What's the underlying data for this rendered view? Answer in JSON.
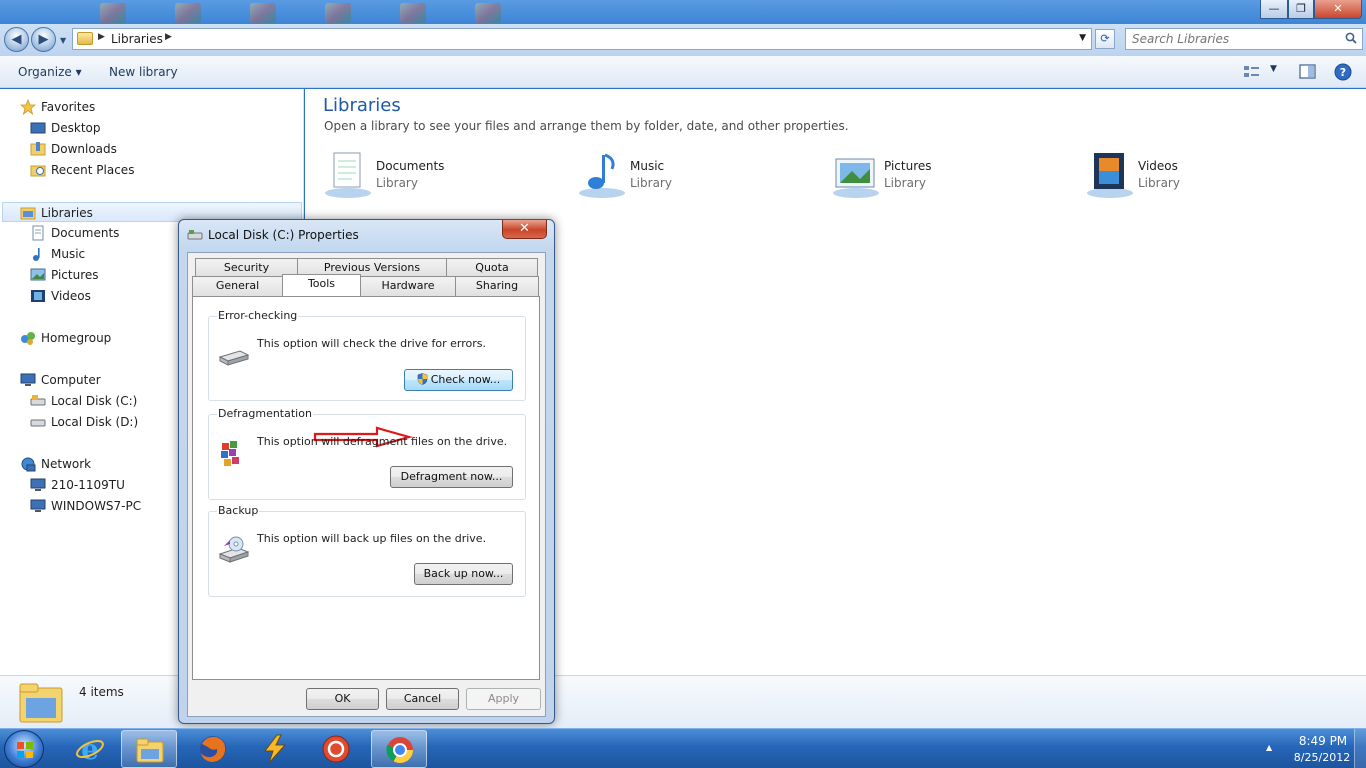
{
  "window": {
    "minimize_glyph": "—",
    "maximize_glyph": "❐",
    "close_glyph": "✕"
  },
  "address": {
    "path": "Libraries",
    "search_placeholder": "Search Libraries",
    "back_glyph": "◀",
    "forward_glyph": "▶"
  },
  "toolbar": {
    "organize": "Organize ▾",
    "new_library": "New library"
  },
  "nav": {
    "favorites": "Favorites",
    "desktop": "Desktop",
    "downloads": "Downloads",
    "recent_places": "Recent Places",
    "libraries": "Libraries",
    "documents": "Documents",
    "music": "Music",
    "pictures": "Pictures",
    "videos": "Videos",
    "homegroup": "Homegroup",
    "computer": "Computer",
    "local_c": "Local Disk (C:)",
    "local_d": "Local Disk (D:)",
    "network": "Network",
    "pc1": "210-1109TU",
    "pc2": "WINDOWS7-PC"
  },
  "content": {
    "title": "Libraries",
    "subtitle": "Open a library to see your files and arrange them by folder, date, and other properties.",
    "libraries": [
      {
        "name": "Documents",
        "type": "Library"
      },
      {
        "name": "Music",
        "type": "Library"
      },
      {
        "name": "Pictures",
        "type": "Library"
      },
      {
        "name": "Videos",
        "type": "Library"
      }
    ]
  },
  "details": {
    "count": "4 items"
  },
  "dialog": {
    "title": "Local Disk (C:) Properties",
    "tabs_top": [
      "Security",
      "Previous Versions",
      "Quota"
    ],
    "tabs_bottom": [
      "General",
      "Tools",
      "Hardware",
      "Sharing"
    ],
    "groups": {
      "error": {
        "title": "Error-checking",
        "text": "This option will check the drive for errors.",
        "button": "Check now..."
      },
      "defrag": {
        "title": "Defragmentation",
        "text": "This option will defragment files on the drive.",
        "button": "Defragment now..."
      },
      "backup": {
        "title": "Backup",
        "text": "This option will back up files on the drive.",
        "button": "Back up now..."
      }
    },
    "ok": "OK",
    "cancel": "Cancel",
    "apply": "Apply"
  },
  "taskbar": {
    "time": "8:49 PM",
    "date": "8/25/2012",
    "tray_arrow": "▲"
  }
}
